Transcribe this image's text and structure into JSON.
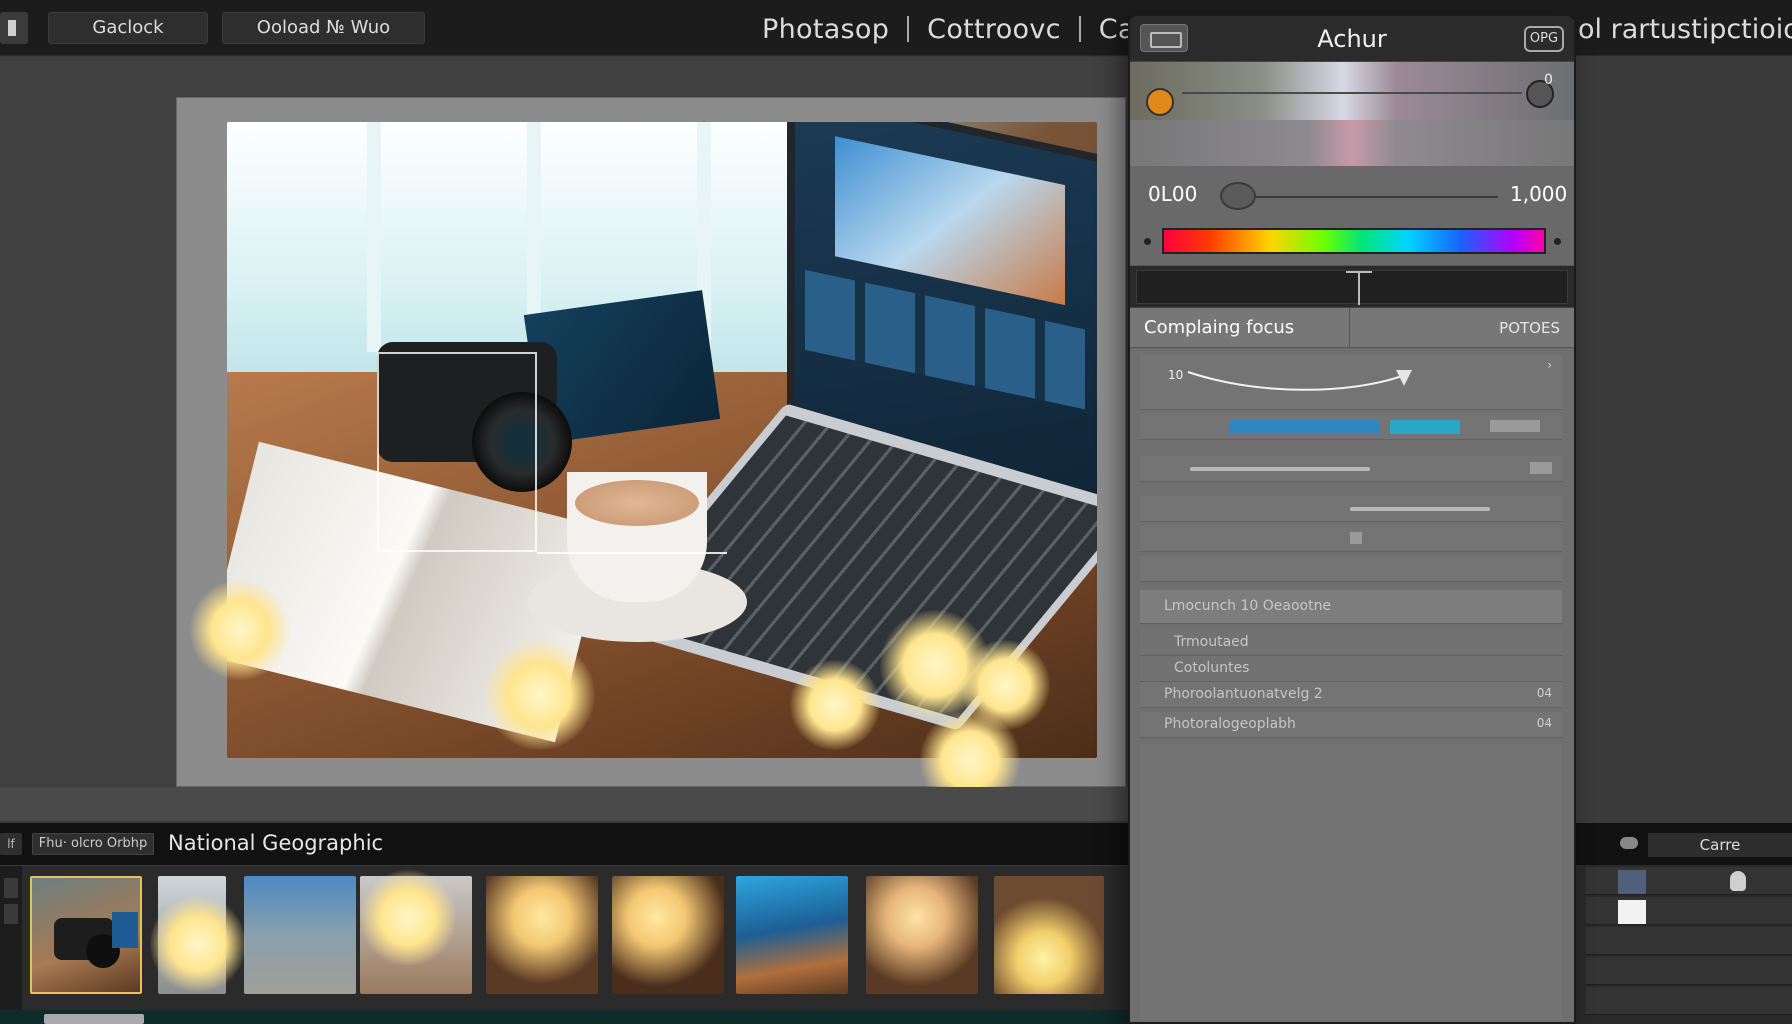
{
  "topbar": {
    "btn1_label": "Gaclock",
    "btn2_label": "Ooload № Wuo",
    "menu": [
      "Photasop",
      "Cottroovc",
      "Card"
    ],
    "right_text": "ol rartustipctioion"
  },
  "filmstrip": {
    "tab_icon": "lf",
    "tab_label": "Fhu· olcro Orbhp",
    "title": "National Geographic",
    "thumbnail_count": 9
  },
  "right_lower": {
    "button_label": "Carre"
  },
  "panel": {
    "title": "Achur",
    "badge": "OPG",
    "gradient": {
      "right_label": "0"
    },
    "hue": {
      "min_label": "0L00",
      "max_label": "1,000"
    },
    "tabs": {
      "tab1": "Complaing focus",
      "tab2": "POTOES"
    },
    "curve_label": "10",
    "rows": [
      {
        "text": "",
        "value": ""
      },
      {
        "text": "",
        "value": ""
      },
      {
        "text": "",
        "value": ""
      },
      {
        "text": "",
        "value": ""
      },
      {
        "text": "",
        "value": ""
      },
      {
        "text": "Lmocunch 10 Oeaootne",
        "value": ""
      },
      {
        "text": "Trmoutaed",
        "value": ""
      },
      {
        "text": "Cotoluntes",
        "value": ""
      },
      {
        "text": "Phoroolantuonatvelg 2",
        "value": "04"
      },
      {
        "text": "Photoralogeoplabh",
        "value": "04"
      }
    ]
  },
  "colors": {
    "accent_orange": "#e18a1b",
    "selection_gold": "#e6c25a",
    "panel_bg": "#6b6b6b",
    "topbar_bg": "#1c1c1c"
  }
}
